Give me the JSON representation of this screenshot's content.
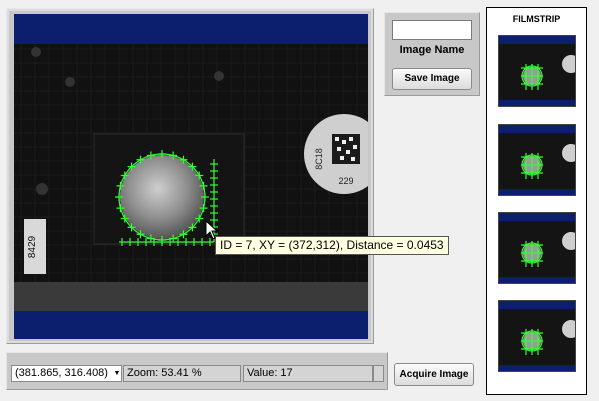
{
  "image_name": {
    "label": "Image Name",
    "value": ""
  },
  "buttons": {
    "save_image": "Save Image",
    "acquire_image": "Acquire Image"
  },
  "status": {
    "coordinates": "(381.865, 316.408)",
    "zoom": "Zoom: 53.41 %",
    "value": "Value: 17"
  },
  "filmstrip": {
    "title": "FILMSTRIP",
    "thumbnail_count": 4
  },
  "tooltip": {
    "text": "ID = 7, XY = (372,312), Distance = 0.0453"
  },
  "image_labels": {
    "chip_code": "8C18",
    "chip_number": "229",
    "side_label": "8429"
  },
  "colors": {
    "overlay": "#33ff33",
    "bands": "#0b1f6e",
    "tooltip_bg": "#ffffe1"
  },
  "icons": {
    "cursor": "arrow-cursor-icon",
    "dropdown": "dropdown-arrow-icon"
  }
}
